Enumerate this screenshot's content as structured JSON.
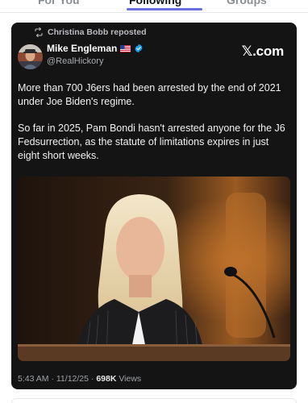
{
  "tabs": [
    {
      "label": "For You"
    },
    {
      "label": "Following"
    },
    {
      "label": "Groups"
    }
  ],
  "post": {
    "repost_text": "Christina Bobb reposted",
    "author_name": "Mike Engleman",
    "author_handle": "@RealHickory",
    "source_logo": "𝕏.com",
    "paragraph1": "More than 700 J6ers had been arrested by the end of 2021 under Joe Biden's regime.",
    "paragraph2": "So far in 2025, Pam Bondi hasn't arrested anyone for the J6 Fedsurrection, as the statute of limitations expires in just eight short weeks.",
    "time": "5:43 AM",
    "separator": " · ",
    "date": "11/12/25",
    "views_count": "698K",
    "views_label": " Views"
  },
  "icons": {
    "repost": "repost-icon",
    "flag": "us-flag-icon",
    "verified": "verified-badge-icon"
  },
  "colors": {
    "card_bg": "#141414",
    "tab_accent": "#6a6ee0",
    "verified": "#1d9bf0"
  }
}
